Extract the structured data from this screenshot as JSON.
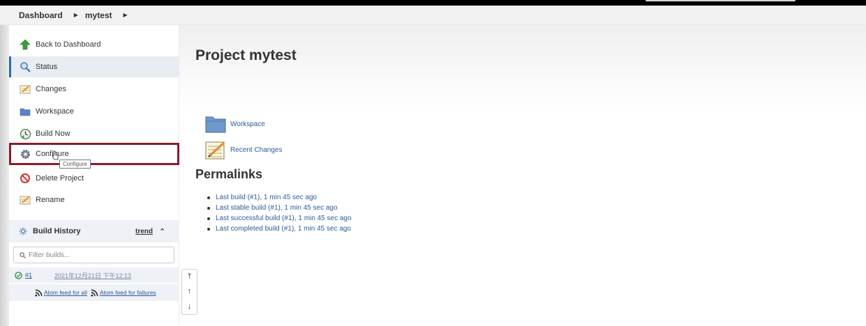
{
  "breadcrumb": {
    "items": [
      "Dashboard",
      "mytest"
    ]
  },
  "sidebar": {
    "tasks": [
      {
        "label": "Back to Dashboard",
        "icon": "up-arrow-icon"
      },
      {
        "label": "Status",
        "icon": "magnifier-icon"
      },
      {
        "label": "Changes",
        "icon": "notepad-icon"
      },
      {
        "label": "Workspace",
        "icon": "folder-icon"
      },
      {
        "label": "Build Now",
        "icon": "build-clock-icon"
      },
      {
        "label": "Configure",
        "icon": "gear-icon"
      },
      {
        "label": "Delete Project",
        "icon": "no-entry-icon"
      },
      {
        "label": "Rename",
        "icon": "notepad-icon"
      }
    ],
    "tooltip": "Configure",
    "build_history": {
      "title": "Build History",
      "trend_label": "trend",
      "filter_placeholder": "Filter builds...",
      "builds": [
        {
          "number": "#1",
          "date": "2021年12月21日 下午12:13",
          "status": "success"
        }
      ],
      "feeds": [
        "Atom feed for all",
        "Atom feed for failures"
      ]
    }
  },
  "main": {
    "title": "Project mytest",
    "links": [
      {
        "label": "Workspace",
        "icon": "folder-icon"
      },
      {
        "label": "Recent Changes",
        "icon": "notepad-icon"
      }
    ],
    "permalinks_title": "Permalinks",
    "permalinks": [
      "Last build (#1), 1 min 45 sec ago",
      "Last stable build (#1), 1 min 45 sec ago",
      "Last successful build (#1), 1 min 45 sec ago",
      "Last completed build (#1), 1 min 45 sec ago"
    ]
  },
  "colors": {
    "accent": "#2b6ab2",
    "link": "#2a5a9a",
    "highlight_box": "#8b1a2b",
    "success": "#2e8b3e"
  }
}
